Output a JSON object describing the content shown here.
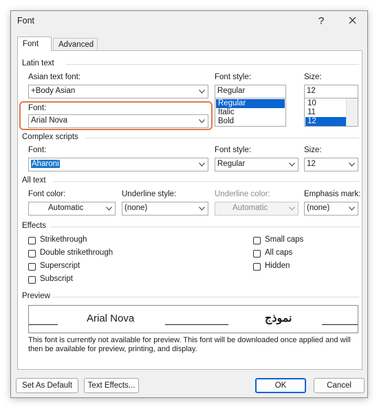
{
  "window": {
    "title": "Font",
    "help": "?",
    "close": "✕"
  },
  "tabs": [
    {
      "label": "Font"
    },
    {
      "label": "Advanced"
    }
  ],
  "latin": {
    "section": "Latin text",
    "asian_label": "Asian text font:",
    "asian_value": "+Body Asian",
    "style_label": "Font style:",
    "style_value": "Regular",
    "style_options": [
      "Regular",
      "Italic",
      "Bold"
    ],
    "size_label": "Size:",
    "size_value": "12",
    "size_options": [
      "10",
      "11",
      "12"
    ],
    "font_label": "Font:",
    "font_value": "Arial Nova"
  },
  "complex": {
    "section": "Complex scripts",
    "font_label": "Font:",
    "font_value": "Aharoni",
    "style_label": "Font style:",
    "style_value": "Regular",
    "size_label": "Size:",
    "size_value": "12"
  },
  "alltext": {
    "section": "All text",
    "color_label": "Font color:",
    "color_value": "Automatic",
    "underline_label": "Underline style:",
    "underline_value": "(none)",
    "ucolor_label": "Underline color:",
    "ucolor_value": "Automatic",
    "emphasis_label": "Emphasis mark:",
    "emphasis_value": "(none)"
  },
  "effects": {
    "section": "Effects",
    "left": [
      "Strikethrough",
      "Double strikethrough",
      "Superscript",
      "Subscript"
    ],
    "right": [
      "Small caps",
      "All caps",
      "Hidden"
    ]
  },
  "preview": {
    "section": "Preview",
    "latin_sample": "Arial Nova",
    "arabic_sample": "نموذج",
    "note": "This font is currently not available for preview. This font will be downloaded once applied and will then be available for preview, printing, and display."
  },
  "buttons": {
    "default": "Set As Default",
    "effects": "Text Effects...",
    "ok": "OK",
    "cancel": "Cancel"
  }
}
